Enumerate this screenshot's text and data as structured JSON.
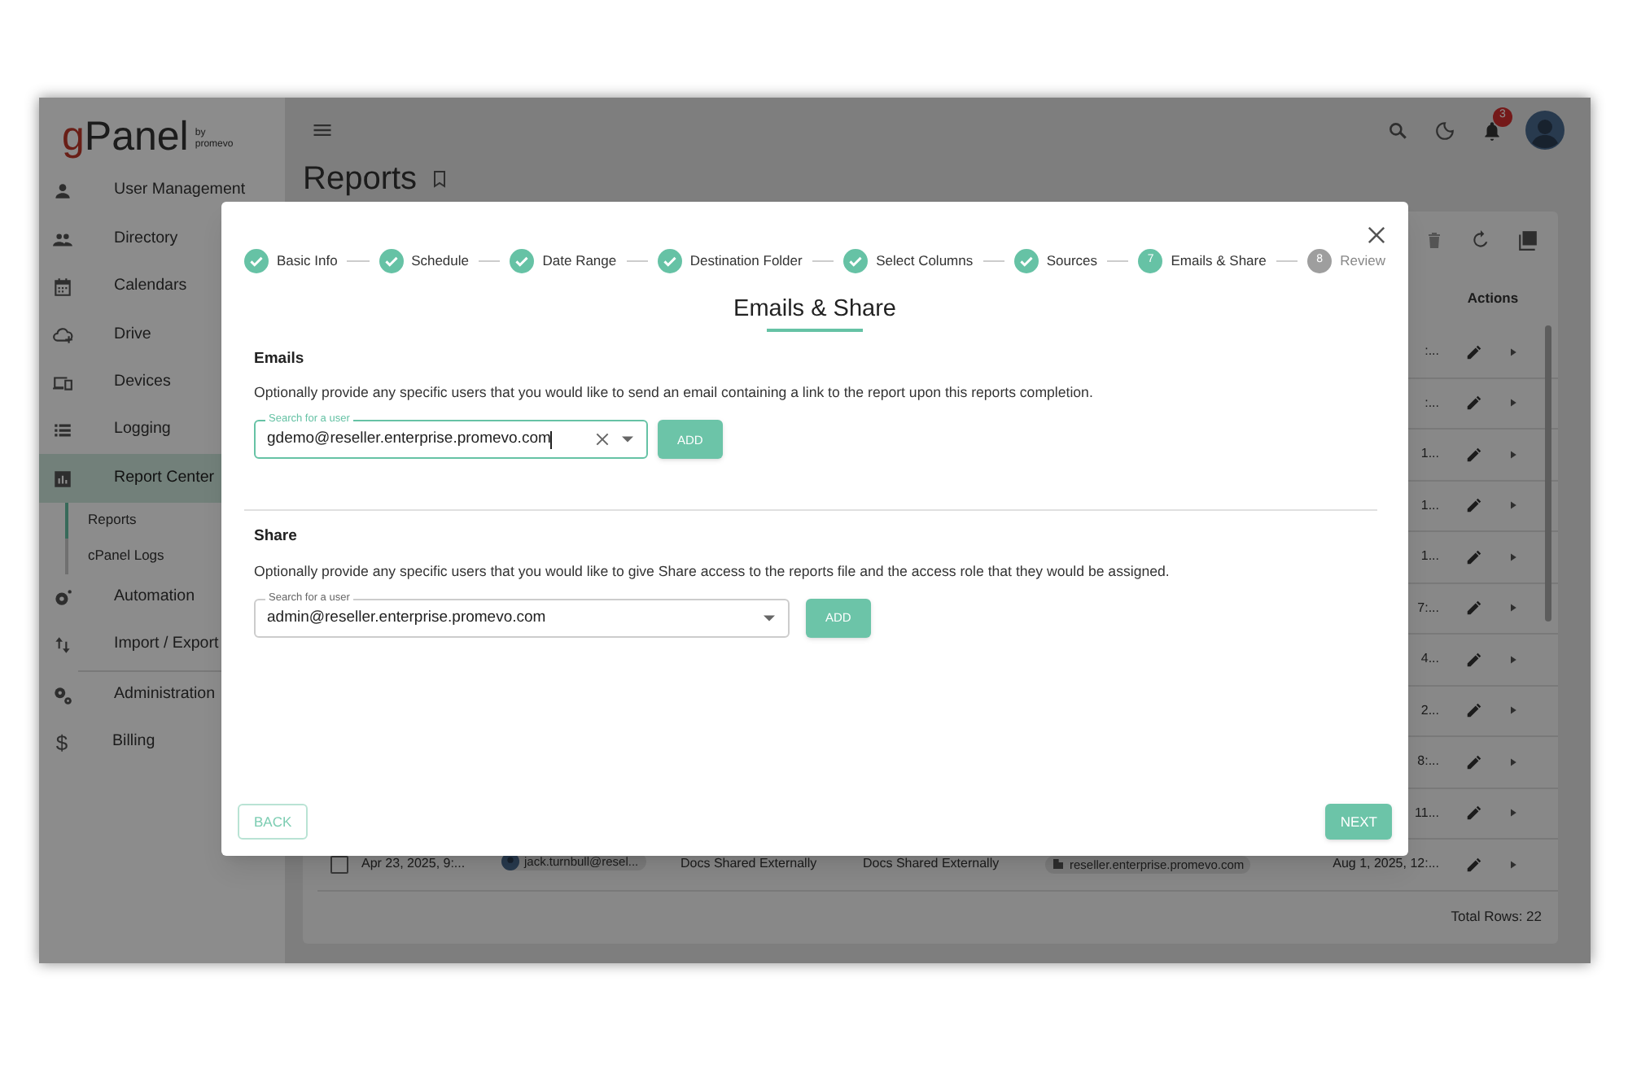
{
  "logo": {
    "first": "g",
    "rest": "Panel",
    "by": "by",
    "maker": "promevo"
  },
  "sidebar": {
    "items": [
      {
        "label": "User Management",
        "selected": false
      },
      {
        "label": "Directory",
        "selected": false
      },
      {
        "label": "Calendars",
        "selected": false
      },
      {
        "label": "Drive",
        "selected": false
      },
      {
        "label": "Devices",
        "selected": false
      },
      {
        "label": "Logging",
        "selected": false
      },
      {
        "label": "Report Center",
        "selected": true,
        "children": [
          {
            "label": "Reports",
            "selected": true
          },
          {
            "label": "cPanel Logs",
            "selected": false
          }
        ]
      },
      {
        "label": "Automation",
        "selected": false
      },
      {
        "label": "Import / Export",
        "selected": false
      },
      {
        "label": "Administration",
        "selected": false
      },
      {
        "label": "Billing",
        "selected": false,
        "glyph": "$"
      }
    ]
  },
  "header": {
    "notification_count": "3"
  },
  "page": {
    "title": "Reports"
  },
  "table": {
    "columns": [
      "Actions"
    ],
    "rows": [
      {
        "column_7": ":..."
      },
      {
        "column_7": ":..."
      },
      {
        "column_7": "1..."
      },
      {
        "column_7": "1..."
      },
      {
        "column_7": "1..."
      },
      {
        "column_7": "7:..."
      },
      {
        "column_7": "4..."
      },
      {
        "column_7": "2..."
      },
      {
        "column_7": "8:..."
      },
      {
        "column_7": "11..."
      },
      {
        "checked": false,
        "column_2": "Apr 23, 2025, 9:...",
        "column_3": "jack.turnbull@resel...",
        "column_4": "Docs Shared Externally",
        "column_5": "Docs Shared Externally",
        "column_6": "reseller.enterprise.promevo.com",
        "column_7": "Aug 1, 2025, 12:..."
      }
    ],
    "footer": "Total Rows: 22"
  },
  "dialog": {
    "steps": [
      {
        "label": "Basic Info",
        "completed": true
      },
      {
        "label": "Schedule",
        "completed": true
      },
      {
        "label": "Date Range",
        "completed": true
      },
      {
        "label": "Destination Folder",
        "completed": true
      },
      {
        "label": "Select Columns",
        "completed": true
      },
      {
        "label": "Sources",
        "completed": true
      },
      {
        "label": "Emails & Share",
        "completed": false,
        "active": true,
        "number": "7"
      },
      {
        "label": "Review",
        "completed": false,
        "active": false,
        "number": "8"
      }
    ],
    "heading": "Emails & Share",
    "sections": [
      {
        "title": "Emails",
        "description": "Optionally provide any specific users that you would like to send an email containing a link to the report upon this reports completion.",
        "field": {
          "label": "Search for a user",
          "value": "gdemo@reseller.enterprise.promevo.com",
          "focused": true,
          "clearable": true
        },
        "button": "ADD"
      },
      {
        "title": "Share",
        "description": "Optionally provide any specific users that you would like to give Share access to the reports file and the access role that they would be assigned.",
        "field": {
          "label": "Search for a user",
          "value": "admin@reseller.enterprise.promevo.com",
          "focused": false,
          "clearable": false
        },
        "button": "ADD"
      }
    ],
    "back_button": "BACK",
    "next_button": "NEXT"
  }
}
